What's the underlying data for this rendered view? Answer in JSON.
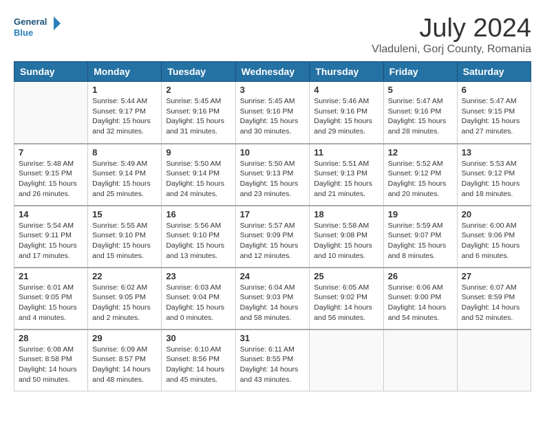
{
  "header": {
    "logo_line1": "General",
    "logo_line2": "Blue",
    "month": "July 2024",
    "location": "Vladuleni, Gorj County, Romania"
  },
  "weekdays": [
    "Sunday",
    "Monday",
    "Tuesday",
    "Wednesday",
    "Thursday",
    "Friday",
    "Saturday"
  ],
  "weeks": [
    [
      {
        "day": "",
        "info": ""
      },
      {
        "day": "1",
        "info": "Sunrise: 5:44 AM\nSunset: 9:17 PM\nDaylight: 15 hours\nand 32 minutes."
      },
      {
        "day": "2",
        "info": "Sunrise: 5:45 AM\nSunset: 9:16 PM\nDaylight: 15 hours\nand 31 minutes."
      },
      {
        "day": "3",
        "info": "Sunrise: 5:45 AM\nSunset: 9:16 PM\nDaylight: 15 hours\nand 30 minutes."
      },
      {
        "day": "4",
        "info": "Sunrise: 5:46 AM\nSunset: 9:16 PM\nDaylight: 15 hours\nand 29 minutes."
      },
      {
        "day": "5",
        "info": "Sunrise: 5:47 AM\nSunset: 9:16 PM\nDaylight: 15 hours\nand 28 minutes."
      },
      {
        "day": "6",
        "info": "Sunrise: 5:47 AM\nSunset: 9:15 PM\nDaylight: 15 hours\nand 27 minutes."
      }
    ],
    [
      {
        "day": "7",
        "info": "Sunrise: 5:48 AM\nSunset: 9:15 PM\nDaylight: 15 hours\nand 26 minutes."
      },
      {
        "day": "8",
        "info": "Sunrise: 5:49 AM\nSunset: 9:14 PM\nDaylight: 15 hours\nand 25 minutes."
      },
      {
        "day": "9",
        "info": "Sunrise: 5:50 AM\nSunset: 9:14 PM\nDaylight: 15 hours\nand 24 minutes."
      },
      {
        "day": "10",
        "info": "Sunrise: 5:50 AM\nSunset: 9:13 PM\nDaylight: 15 hours\nand 23 minutes."
      },
      {
        "day": "11",
        "info": "Sunrise: 5:51 AM\nSunset: 9:13 PM\nDaylight: 15 hours\nand 21 minutes."
      },
      {
        "day": "12",
        "info": "Sunrise: 5:52 AM\nSunset: 9:12 PM\nDaylight: 15 hours\nand 20 minutes."
      },
      {
        "day": "13",
        "info": "Sunrise: 5:53 AM\nSunset: 9:12 PM\nDaylight: 15 hours\nand 18 minutes."
      }
    ],
    [
      {
        "day": "14",
        "info": "Sunrise: 5:54 AM\nSunset: 9:11 PM\nDaylight: 15 hours\nand 17 minutes."
      },
      {
        "day": "15",
        "info": "Sunrise: 5:55 AM\nSunset: 9:10 PM\nDaylight: 15 hours\nand 15 minutes."
      },
      {
        "day": "16",
        "info": "Sunrise: 5:56 AM\nSunset: 9:10 PM\nDaylight: 15 hours\nand 13 minutes."
      },
      {
        "day": "17",
        "info": "Sunrise: 5:57 AM\nSunset: 9:09 PM\nDaylight: 15 hours\nand 12 minutes."
      },
      {
        "day": "18",
        "info": "Sunrise: 5:58 AM\nSunset: 9:08 PM\nDaylight: 15 hours\nand 10 minutes."
      },
      {
        "day": "19",
        "info": "Sunrise: 5:59 AM\nSunset: 9:07 PM\nDaylight: 15 hours\nand 8 minutes."
      },
      {
        "day": "20",
        "info": "Sunrise: 6:00 AM\nSunset: 9:06 PM\nDaylight: 15 hours\nand 6 minutes."
      }
    ],
    [
      {
        "day": "21",
        "info": "Sunrise: 6:01 AM\nSunset: 9:05 PM\nDaylight: 15 hours\nand 4 minutes."
      },
      {
        "day": "22",
        "info": "Sunrise: 6:02 AM\nSunset: 9:05 PM\nDaylight: 15 hours\nand 2 minutes."
      },
      {
        "day": "23",
        "info": "Sunrise: 6:03 AM\nSunset: 9:04 PM\nDaylight: 15 hours\nand 0 minutes."
      },
      {
        "day": "24",
        "info": "Sunrise: 6:04 AM\nSunset: 9:03 PM\nDaylight: 14 hours\nand 58 minutes."
      },
      {
        "day": "25",
        "info": "Sunrise: 6:05 AM\nSunset: 9:02 PM\nDaylight: 14 hours\nand 56 minutes."
      },
      {
        "day": "26",
        "info": "Sunrise: 6:06 AM\nSunset: 9:00 PM\nDaylight: 14 hours\nand 54 minutes."
      },
      {
        "day": "27",
        "info": "Sunrise: 6:07 AM\nSunset: 8:59 PM\nDaylight: 14 hours\nand 52 minutes."
      }
    ],
    [
      {
        "day": "28",
        "info": "Sunrise: 6:08 AM\nSunset: 8:58 PM\nDaylight: 14 hours\nand 50 minutes."
      },
      {
        "day": "29",
        "info": "Sunrise: 6:09 AM\nSunset: 8:57 PM\nDaylight: 14 hours\nand 48 minutes."
      },
      {
        "day": "30",
        "info": "Sunrise: 6:10 AM\nSunset: 8:56 PM\nDaylight: 14 hours\nand 45 minutes."
      },
      {
        "day": "31",
        "info": "Sunrise: 6:11 AM\nSunset: 8:55 PM\nDaylight: 14 hours\nand 43 minutes."
      },
      {
        "day": "",
        "info": ""
      },
      {
        "day": "",
        "info": ""
      },
      {
        "day": "",
        "info": ""
      }
    ]
  ]
}
